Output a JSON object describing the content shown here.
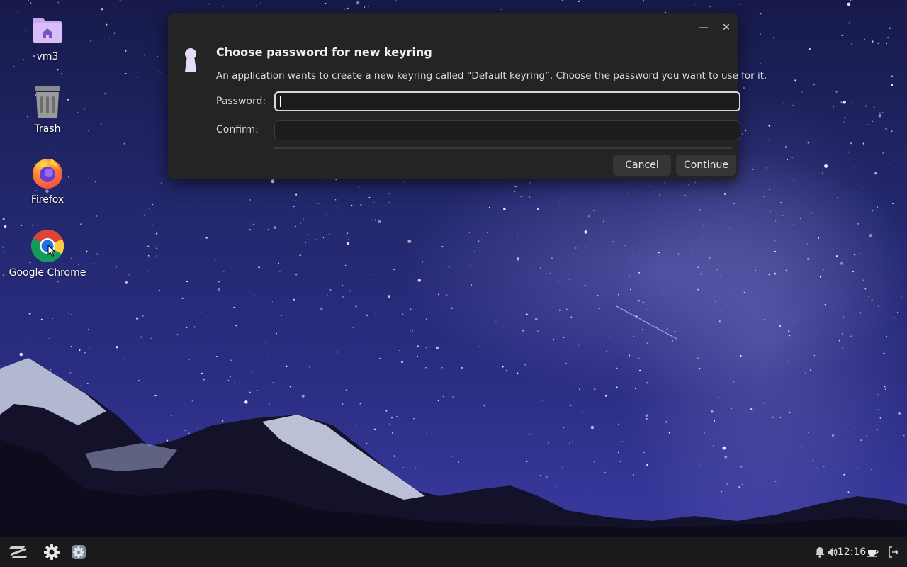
{
  "desktop": {
    "icons": [
      {
        "label": "vm3",
        "icon": "home-folder-icon"
      },
      {
        "label": "Trash",
        "icon": "trash-icon"
      },
      {
        "label": "Firefox",
        "icon": "firefox-icon"
      },
      {
        "label": "Google Chrome",
        "icon": "chrome-icon"
      }
    ]
  },
  "dialog": {
    "title": "Choose password for new keyring",
    "description": "An application wants to create a new keyring called “Default keyring”. Choose the password you want to use for it.",
    "password_label": "Password:",
    "password_value": "",
    "confirm_label": "Confirm:",
    "confirm_value": "",
    "cancel_label": "Cancel",
    "continue_label": "Continue",
    "minimize_icon": "minimize-icon",
    "close_icon": "close-icon",
    "dialog_icon": "keyhole-icon"
  },
  "taskbar": {
    "menu_icon": "zorin-menu-icon",
    "settings_icon": "gear-icon",
    "app_icon": "settings-app-icon",
    "notification_icon": "bell-icon",
    "volume_icon": "volume-icon",
    "clock": "12:16",
    "caffeine_icon": "coffee-cup-icon",
    "logout_icon": "logout-icon"
  },
  "colors": {
    "dialog_bg": "#242424",
    "taskbar_bg": "#1a1a1c",
    "sky_top": "#171a4a",
    "sky_bottom": "#3a3aa0"
  }
}
